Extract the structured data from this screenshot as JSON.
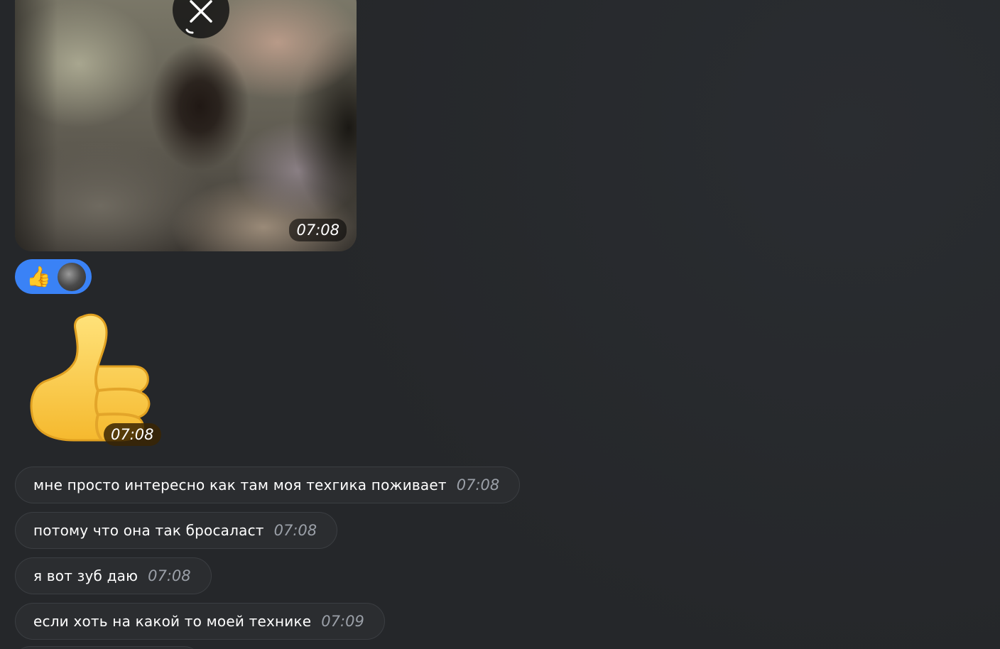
{
  "media_message": {
    "time": "07:08",
    "cancel_icon": "close-icon"
  },
  "reaction": {
    "emoji": "👍",
    "avatar_icon": "avatar"
  },
  "sticker_message": {
    "sticker_icon": "thumbs-up-icon",
    "time": "07:08"
  },
  "messages": [
    {
      "text": "мне просто интересно как там моя техгика поживает",
      "time": "07:08"
    },
    {
      "text": "потому что она так бросаласт",
      "time": "07:08"
    },
    {
      "text": "я вот зуб даю",
      "time": "07:08"
    },
    {
      "text": "если хоть на какой то моей технике",
      "time": "07:09"
    }
  ],
  "colors": {
    "background": "#25272a",
    "bubble": "#2b2d30",
    "reaction_bg": "#3a82f6",
    "time_text": "#9a9fa7"
  }
}
